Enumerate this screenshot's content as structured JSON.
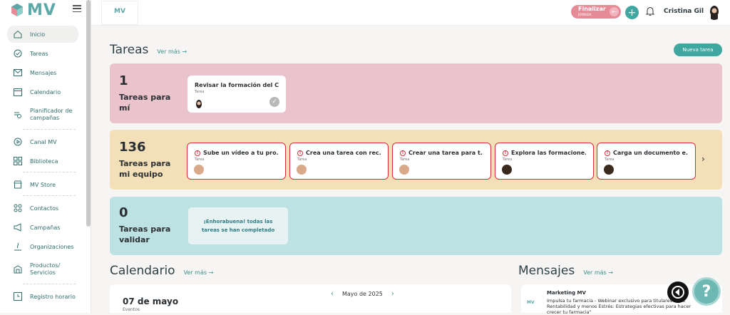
{
  "app": {
    "logo_text": "MV"
  },
  "sidebar": {
    "items": [
      {
        "label": "Inicio",
        "icon": "home-icon"
      },
      {
        "label": "Tareas",
        "icon": "check-circle-icon"
      },
      {
        "label": "Mensajes",
        "icon": "mail-icon"
      },
      {
        "label": "Calendario",
        "icon": "calendar-icon"
      },
      {
        "label": "Planificador de campañas",
        "icon": "planner-icon"
      },
      {
        "label": "Canal MV",
        "icon": "play-icon"
      },
      {
        "label": "Biblioteca",
        "icon": "grid-icon"
      },
      {
        "label": "MV Store",
        "icon": "store-icon"
      },
      {
        "label": "Contactos",
        "icon": "contacts-icon"
      },
      {
        "label": "Campañas",
        "icon": "megaphone-icon"
      },
      {
        "label": "Organizaciones",
        "icon": "organization-icon"
      },
      {
        "label": "Productos/ Servicios",
        "icon": "products-icon"
      },
      {
        "label": "Registro horario",
        "icon": "clock-icon"
      }
    ]
  },
  "topbar": {
    "finalizar_label": "Finalizar",
    "finalizar_sub": "JORNADA",
    "user_name": "Cristina Gil"
  },
  "tareas": {
    "title": "Tareas",
    "ver_mas": "Ver más →",
    "new_button": "Nueva tarea",
    "mine": {
      "count": "1",
      "label": "Tareas para mí",
      "cards": [
        {
          "title": "Revisar la formación del C...",
          "type": "Tarea"
        }
      ]
    },
    "team": {
      "count": "136",
      "label": "Tareas para mi equipo",
      "cards": [
        {
          "title": "Sube un vídeo a tu pro...",
          "type": "Tarea"
        },
        {
          "title": "Crea una tarea con rec...",
          "type": "Tarea"
        },
        {
          "title": "Crear una tarea para t...",
          "type": "Tarea"
        },
        {
          "title": "Explora las formacione...",
          "type": "Tarea"
        },
        {
          "title": "Carga un documento e...",
          "type": "Tarea"
        }
      ]
    },
    "validate": {
      "count": "0",
      "label": "Tareas para validar",
      "empty_message": "¡Enhorabuena! todas las tareas se han completado"
    }
  },
  "calendario": {
    "title": "Calendario",
    "ver_mas": "Ver más →",
    "date": "07 de mayo",
    "events_label": "Eventos",
    "month": "Mayo de 2025"
  },
  "mensajes": {
    "title": "Mensajes",
    "ver_mas": "Ver más →",
    "from": "Marketing MV",
    "body": "Impulsa tu farmacia - Webinar exclusivo para titulares \"Más Rentabilidad y menos Estrés: Estrategias efectivas para hacer crecer tu farmacia\""
  },
  "colors": {
    "accent": "#3fa79f",
    "mine_bg": "#ebc3cc",
    "team_bg": "#f3e0b8",
    "validate_bg": "#bde2e3",
    "alert": "#d92b3a"
  }
}
